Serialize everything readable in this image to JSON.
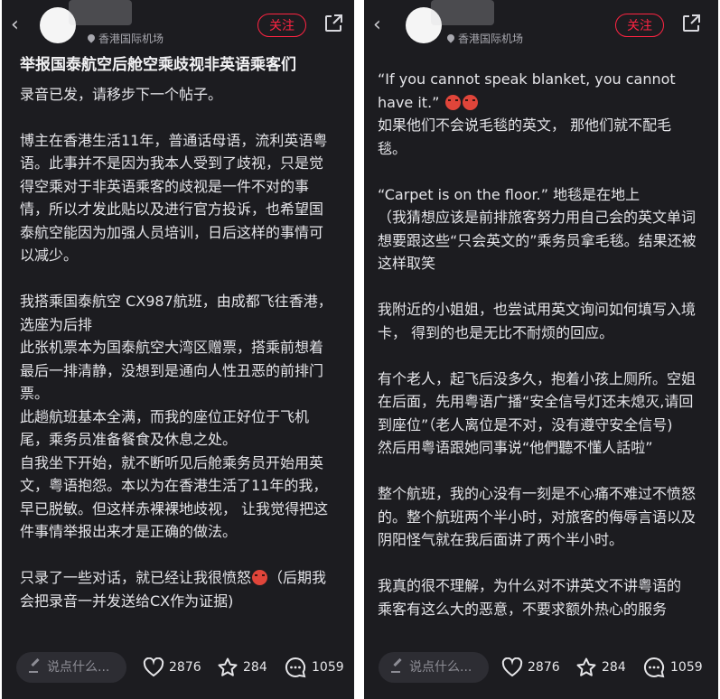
{
  "colors": {
    "background": "#1c1c20",
    "accent": "#ff2442",
    "text": "#e4e4e8",
    "muted": "#a9a9b0"
  },
  "left": {
    "header": {
      "location": "香港国际机场",
      "follow_label": "关注"
    },
    "title": "举报国泰航空后舱空乘歧视非英语乘客们",
    "paragraphs": [
      "录音已发，请移步下一个帖子。",
      "博主在香港生活11年，普通话母语，流利英语粤语。此事并不是因为我本人受到了歧视，只是觉得空乘对于非英语乘客的歧视是一件不对的事情，所以才发此贴以及进行官方投诉，也希望国泰航空能因为加强人员培训，日后这样的事情可以减少。",
      "我搭乘国泰航空 CX987航班，由成都飞往香港，选座为后排",
      "此张机票本为国泰航空大湾区赠票，搭乘前想着最后一排清静，没想到是通向人性丑恶的前排门票。",
      "此趟航班基本全满，而我的座位正好位于飞机尾，乘务员准备餐食及休息之处。",
      "自我坐下开始，就不断听见后舱乘务员开始用英文，粤语抱怨。本以为在香港生活了11年的我，早已脱敏。但这样赤裸裸地歧视， 让我觉得把这件事情举报出来才是正确的做法。",
      "只录了一些对话，就已经让我很愤怒",
      "（后期我会把录音一并发送给CX作为证据)"
    ],
    "stats": {
      "comment_placeholder": "说点什么...",
      "likes": "2876",
      "stars": "284",
      "comments": "1059"
    }
  },
  "right": {
    "header": {
      "location": "香港国际机场",
      "follow_label": "关注"
    },
    "paragraphs": [
      "“If you cannot speak blanket, you cannot have it.”",
      "如果他们不会说毛毯的英文， 那他们就不配毛毯。",
      "“Carpet is on the floor.” 地毯是在地上",
      "（我猜想应该是前排旅客努力用自己会的英文单词想要跟这些“只会英文的”乘务员拿毛毯。结果还被这样取笑",
      "我附近的小姐姐，也尝试用英文询问如何填写入境卡， 得到的也是无比不耐烦的回应。",
      "有个老人，起飞后没多久，抱着小孩上厕所。空姐在后面，先用粤语广播“安全信号灯还未熄灭,请回到座位”（老人离位是不对，没有遵守安全信号)",
      "然后用粤语跟她同事说“他們聽不懂人話啦”",
      "整个航班，我的心没有一刻是不心痛不难过不愤怒的。整个航班两个半小时，对旅客的侮辱言语以及阴阳怪气就在我后面讲了两个半小时。",
      "我真的很不理解，为什么对不讲英文不讲粤语的",
      "乘客有这么大的恶意，不要求额外热心的服务"
    ],
    "stats": {
      "comment_placeholder": "说点什么...",
      "likes": "2876",
      "stars": "284",
      "comments": "1059"
    }
  }
}
